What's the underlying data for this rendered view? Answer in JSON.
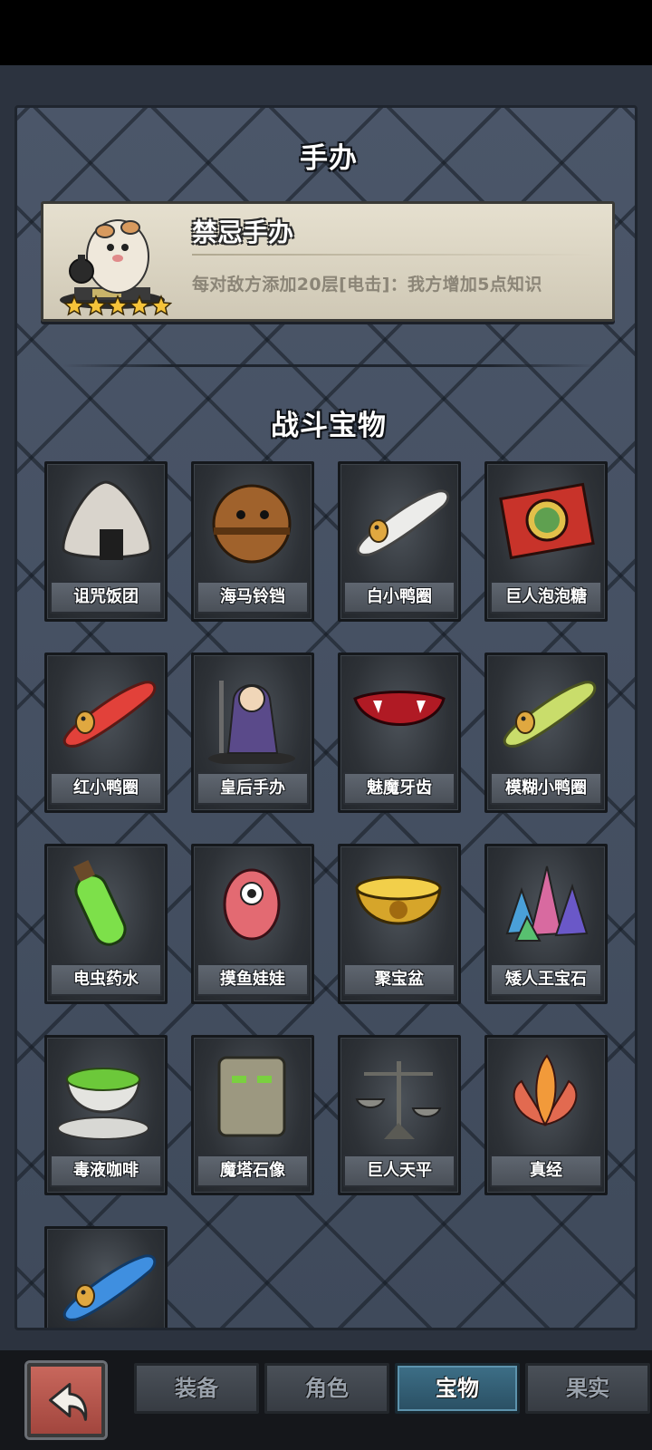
{
  "sections": {
    "figure_title": "手办",
    "battle_title": "战斗宝物"
  },
  "figure": {
    "name": "禁忌手办",
    "description": "每对敌方添加20层[电击]：我方增加5点知识",
    "stars": 5
  },
  "treasures": [
    {
      "label": "诅咒饭团",
      "icon": "rice-ball-icon"
    },
    {
      "label": "海马铃铛",
      "icon": "bell-icon"
    },
    {
      "label": "白小鸭圈",
      "icon": "white-duck-ring-icon"
    },
    {
      "label": "巨人泡泡糖",
      "icon": "bubblegum-icon"
    },
    {
      "label": "红小鸭圈",
      "icon": "red-duck-ring-icon"
    },
    {
      "label": "皇后手办",
      "icon": "queen-figure-icon"
    },
    {
      "label": "魅魔牙齿",
      "icon": "fangs-icon"
    },
    {
      "label": "模糊小鸭圈",
      "icon": "green-duck-ring-icon"
    },
    {
      "label": "电虫药水",
      "icon": "potion-icon"
    },
    {
      "label": "摸鱼娃娃",
      "icon": "doll-icon"
    },
    {
      "label": "聚宝盆",
      "icon": "treasure-bowl-icon"
    },
    {
      "label": "矮人王宝石",
      "icon": "gems-icon"
    },
    {
      "label": "毒液咖啡",
      "icon": "coffee-cup-icon"
    },
    {
      "label": "魔塔石像",
      "icon": "stone-statue-icon"
    },
    {
      "label": "巨人天平",
      "icon": "scales-icon"
    },
    {
      "label": "真经",
      "icon": "lotus-icon"
    },
    {
      "label": "",
      "icon": "blue-duck-ring-icon"
    }
  ],
  "tabs": [
    {
      "label": "装备",
      "active": false
    },
    {
      "label": "角色",
      "active": false
    },
    {
      "label": "宝物",
      "active": true
    },
    {
      "label": "果实",
      "active": false
    }
  ],
  "colors": {
    "panel": "#465263",
    "card": "#e6e0cf",
    "active_tab": "#3d6f87",
    "back_button": "#b8564c"
  }
}
